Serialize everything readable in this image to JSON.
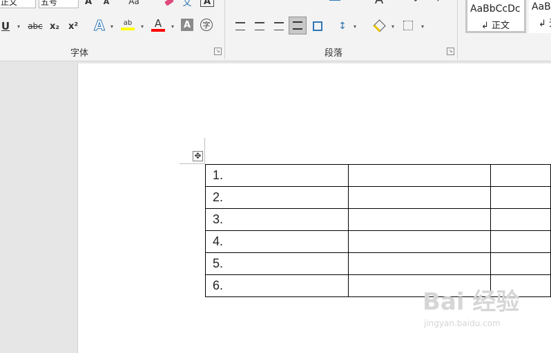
{
  "ribbon": {
    "font_group": {
      "label": "字体",
      "style_box_value": "正文",
      "size_box_value": "五号",
      "grow_font": "A",
      "shrink_font": "A",
      "change_case": "Aa",
      "phonetic_guide": "文",
      "char_border": "A",
      "underline": "U",
      "strikethrough": "abc",
      "subscript": "x₂",
      "superscript": "x²",
      "text_effects": "A",
      "highlight": "ab",
      "font_color": "A",
      "char_shading": "A",
      "enclose_char": "字",
      "highlight_color": "#ffff00",
      "font_color_value": "#ff0000"
    },
    "paragraph_group": {
      "label": "段落"
    },
    "styles_group": {
      "styles": [
        {
          "sample": "AaBbCcDc",
          "name": "正文"
        },
        {
          "sample": "AaB",
          "name": "无"
        }
      ]
    }
  },
  "document": {
    "table": {
      "rows": [
        [
          "1.",
          "",
          ""
        ],
        [
          "2.",
          "",
          ""
        ],
        [
          "3.",
          "",
          ""
        ],
        [
          "4.",
          "",
          ""
        ],
        [
          "5.",
          "",
          ""
        ],
        [
          "6.",
          "",
          ""
        ]
      ]
    }
  },
  "watermark": {
    "logo": "Bai 经验",
    "url": "jingyan.baidu.com"
  }
}
